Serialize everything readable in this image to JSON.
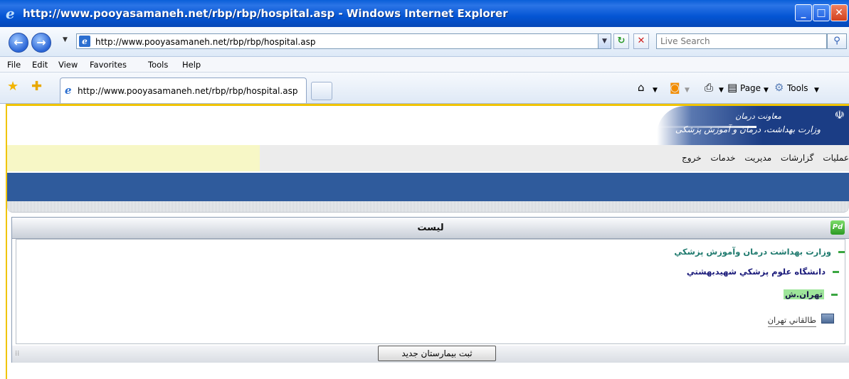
{
  "window": {
    "title": "http://www.pooyasamaneh.net/rbp/rbp/hospital.asp - Windows Internet Explorer",
    "controls": [
      "minimize",
      "maximize",
      "close"
    ]
  },
  "address_bar": {
    "url": "http://www.pooyasamaneh.net/rbp/rbp/hospital.asp",
    "search_placeholder": "Live Search"
  },
  "menu": [
    "File",
    "Edit",
    "View",
    "Favorites",
    "Tools",
    "Help"
  ],
  "tab": {
    "label": "http://www.pooyasamaneh.net/rbp/rbp/hospital.asp"
  },
  "command_bar": {
    "page_label": "Page",
    "tools_label": "Tools"
  },
  "site": {
    "banner_line1": "معاونت درمان",
    "banner_line2": "وزارت بهداشت، درمان و آموزش پزشکی",
    "nav": [
      "عملیات",
      "گزارشات",
      "مدیریت",
      "خدمات",
      "خروج"
    ]
  },
  "panel": {
    "title": "لیست",
    "tree": {
      "level1": "وزارت بهداشت درمان وآموزش پزشکي",
      "level2": "دانشگاه علوم پزشکي شهيدبهشتي",
      "level3": "تهران.ش",
      "hospital": "طالقاني تهران"
    },
    "new_button": "ثبت بيمارستان جديد"
  },
  "colors": {
    "title_bar": "#0455d4",
    "page_border": "#f0c400",
    "blue_band": "#2f5b9c",
    "tree_level1": "#1f7a6e",
    "tree_level2": "#1a1a7a",
    "highlight": "#9ee59a"
  }
}
